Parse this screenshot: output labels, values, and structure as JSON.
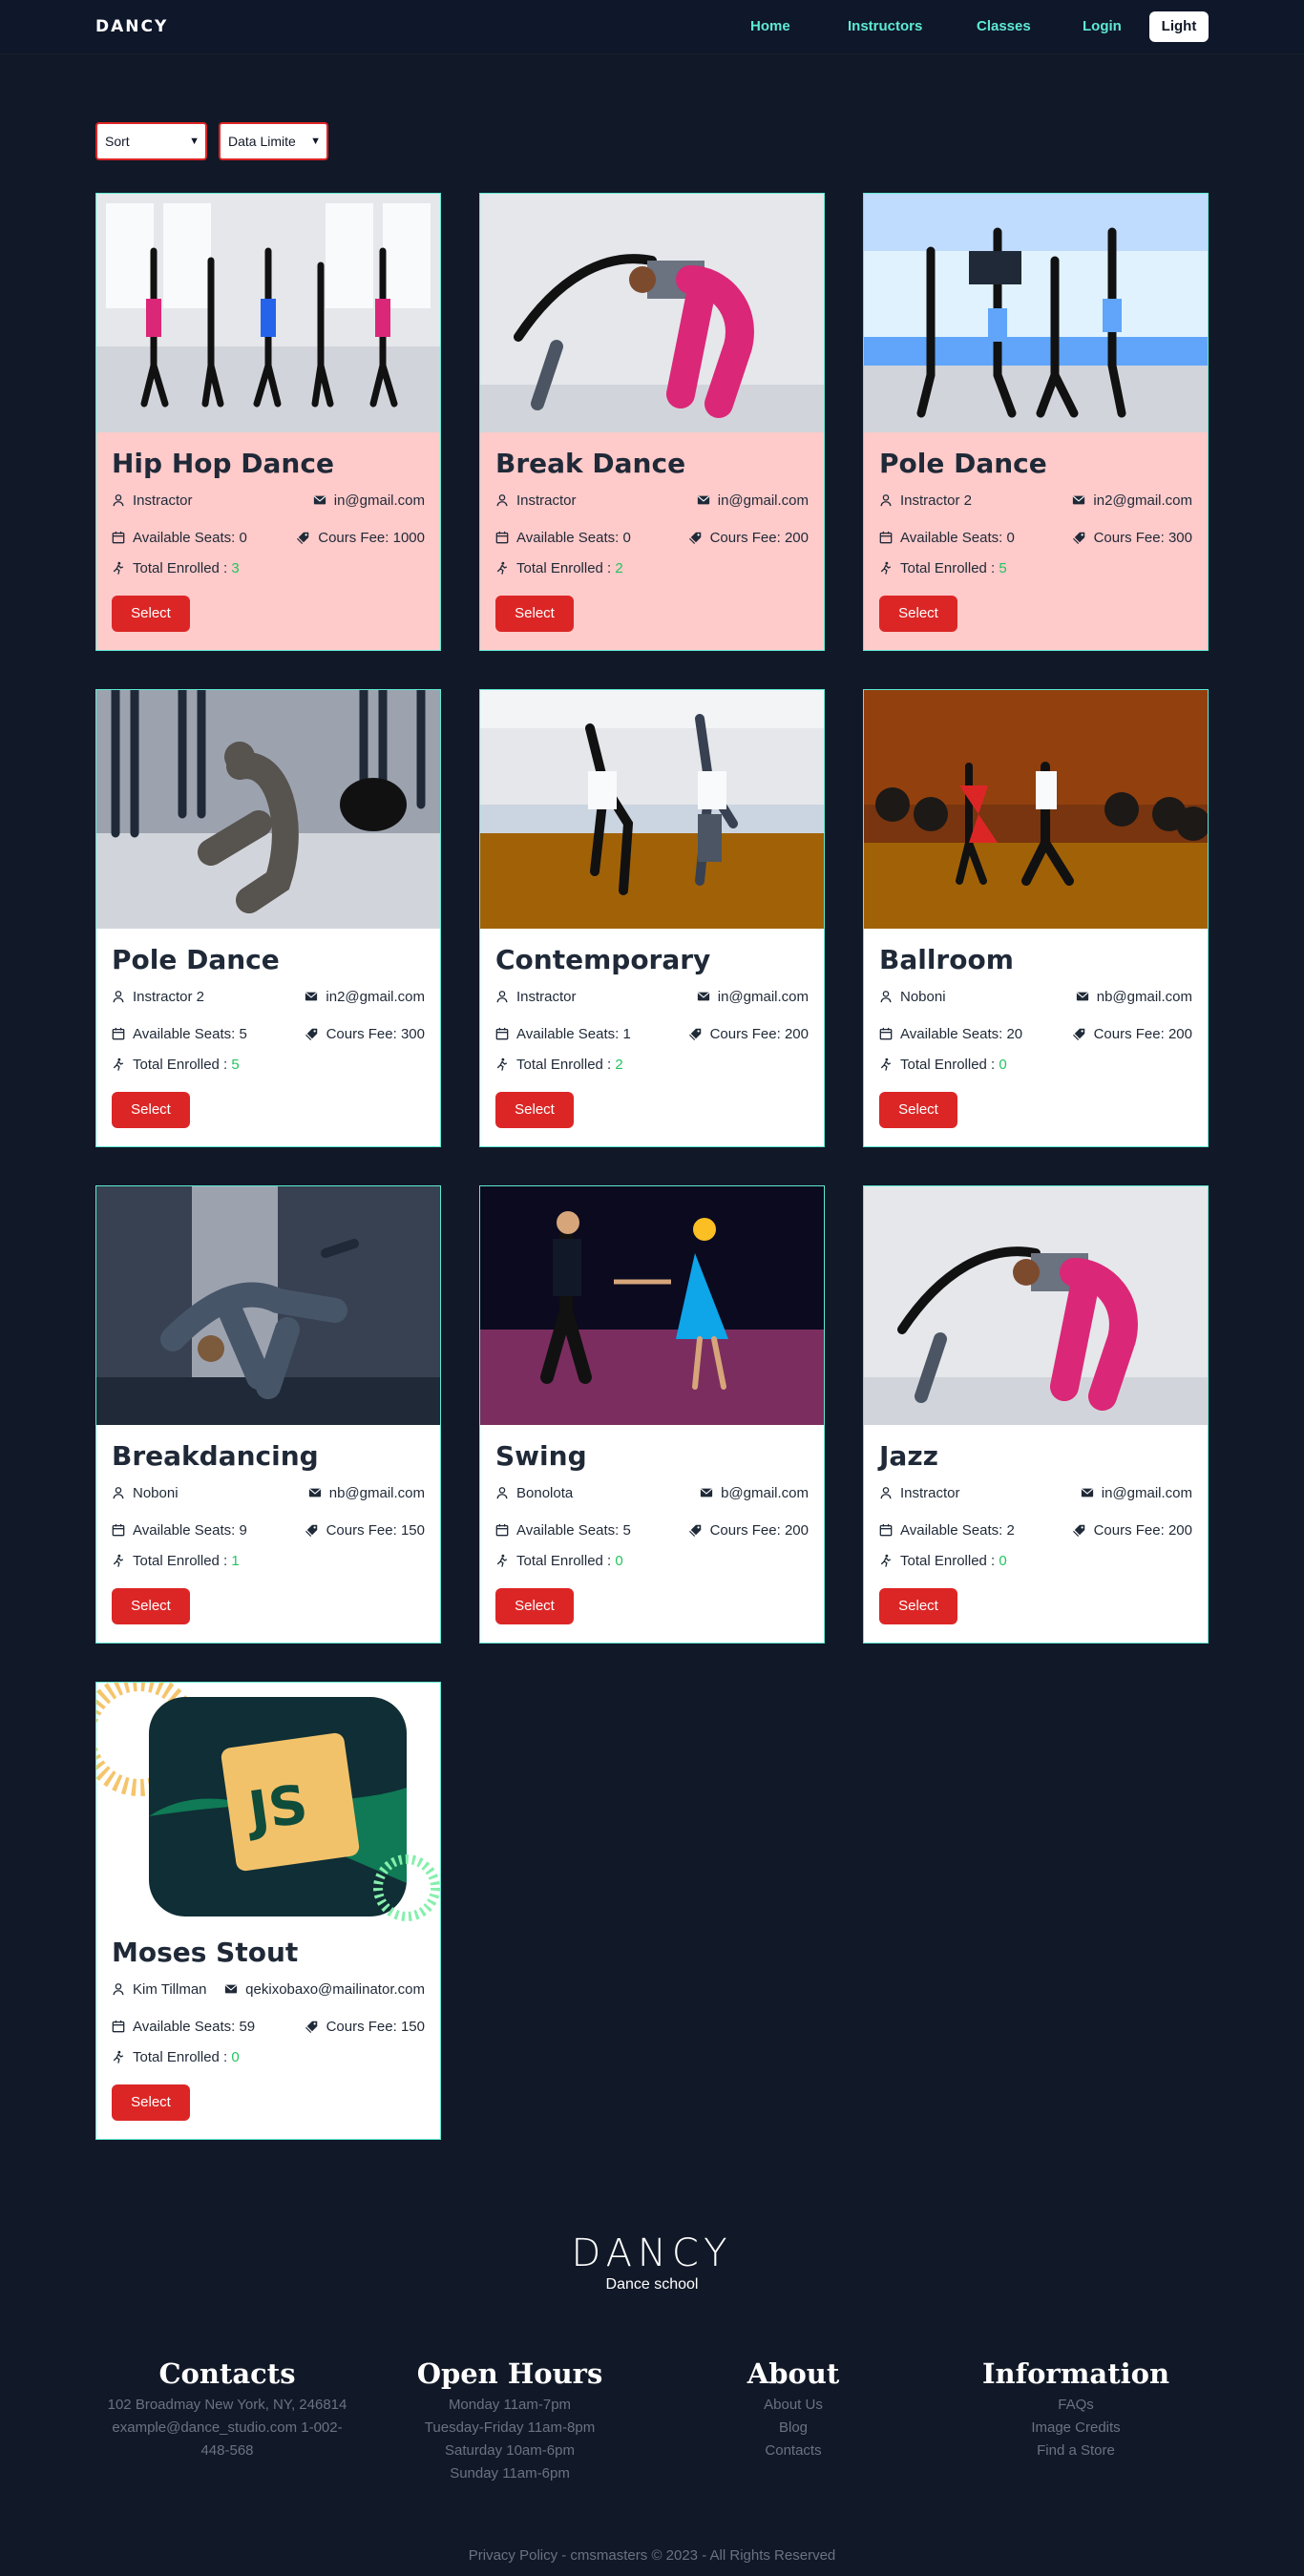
{
  "nav": {
    "logo": "DANCY",
    "links": [
      "Home",
      "Instructors",
      "Classes",
      "Login"
    ],
    "theme_toggle": "Light"
  },
  "filters": {
    "sort": "Sort",
    "data_limit": "Data Limite"
  },
  "labels": {
    "available_seats": "Available Seats:",
    "course_fee": "Cours Fee:",
    "total_enrolled": "Total Enrolled :",
    "select": "Select"
  },
  "classes": [
    {
      "title": "Hip Hop Dance",
      "instructor": "Instractor",
      "email": "in@gmail.com",
      "seats": "0",
      "fee": "1000",
      "enrolled": "3",
      "highlight": true
    },
    {
      "title": "Break Dance",
      "instructor": "Instractor",
      "email": "in@gmail.com",
      "seats": "0",
      "fee": "200",
      "enrolled": "2",
      "highlight": true
    },
    {
      "title": "Pole Dance",
      "instructor": "Instractor 2",
      "email": "in2@gmail.com",
      "seats": "0",
      "fee": "300",
      "enrolled": "5",
      "highlight": true
    },
    {
      "title": "Pole Dance",
      "instructor": "Instractor 2",
      "email": "in2@gmail.com",
      "seats": "5",
      "fee": "300",
      "enrolled": "5",
      "highlight": false
    },
    {
      "title": "Contemporary",
      "instructor": "Instractor",
      "email": "in@gmail.com",
      "seats": "1",
      "fee": "200",
      "enrolled": "2",
      "highlight": false
    },
    {
      "title": "Ballroom",
      "instructor": "Noboni",
      "email": "nb@gmail.com",
      "seats": "20",
      "fee": "200",
      "enrolled": "0",
      "highlight": false
    },
    {
      "title": "Breakdancing",
      "instructor": "Noboni",
      "email": "nb@gmail.com",
      "seats": "9",
      "fee": "150",
      "enrolled": "1",
      "highlight": false
    },
    {
      "title": "Swing",
      "instructor": "Bonolota",
      "email": "b@gmail.com",
      "seats": "5",
      "fee": "200",
      "enrolled": "0",
      "highlight": false
    },
    {
      "title": "Jazz",
      "instructor": "Instractor",
      "email": "in@gmail.com",
      "seats": "2",
      "fee": "200",
      "enrolled": "0",
      "highlight": false
    },
    {
      "title": "Moses Stout",
      "instructor": "Kim Tillman",
      "email": "qekixobaxo@mailinator.com",
      "seats": "59",
      "fee": "150",
      "enrolled": "0",
      "highlight": false
    }
  ],
  "footer": {
    "logo": "DANCY",
    "tagline": "Dance school",
    "contacts": {
      "title": "Contacts",
      "lines": [
        "102 Broadmay New York, NY, 246814",
        "example@dance_studio.com 1-002-",
        "448-568"
      ]
    },
    "hours": {
      "title": "Open Hours",
      "lines": [
        "Monday 11am-7pm",
        "Tuesday-Friday 11am-8pm",
        "Saturday 10am-6pm",
        "Sunday 11am-6pm"
      ]
    },
    "about": {
      "title": "About",
      "lines": [
        "About Us",
        "Blog",
        "Contacts"
      ]
    },
    "information": {
      "title": "Information",
      "lines": [
        "FAQs",
        "Image Credits",
        "Find a Store"
      ]
    },
    "copyright": "Privacy Policy - cmsmasters © 2023 - All Rights Reserved"
  },
  "colors": {
    "background": "#111827",
    "accent_teal": "#5eead4",
    "button_red": "#dc2626",
    "card_pink": "#fecaca",
    "enrolled_green": "#22c55e"
  }
}
